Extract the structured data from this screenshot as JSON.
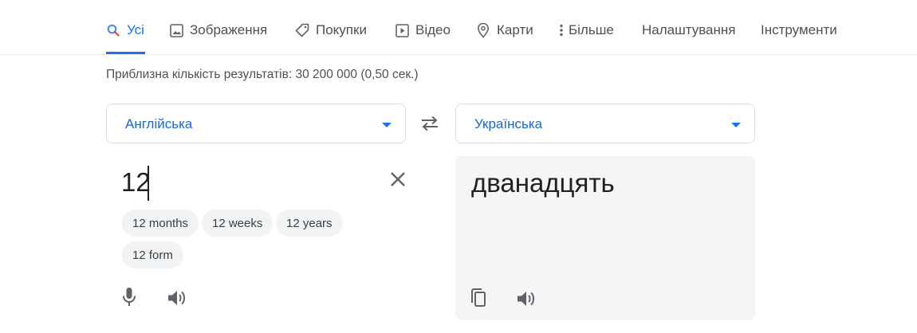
{
  "nav": {
    "tabs": [
      {
        "label": "Усі",
        "icon": "search-icon"
      },
      {
        "label": "Зображення",
        "icon": "image-icon"
      },
      {
        "label": "Покупки",
        "icon": "tag-icon"
      },
      {
        "label": "Відео",
        "icon": "play-icon"
      },
      {
        "label": "Карти",
        "icon": "map-pin-icon"
      },
      {
        "label": "Більше",
        "icon": "more-vert-icon"
      },
      {
        "label": "Налаштування"
      },
      {
        "label": "Інструменти"
      }
    ]
  },
  "results": {
    "text": "Приблизна кількість результатів: 30 200 000 (0,50 сек.)"
  },
  "translator": {
    "source_lang": "Англійська",
    "target_lang": "Українська",
    "source_text": "12",
    "target_text": "дванадцять",
    "suggestions": [
      "12 months",
      "12 weeks",
      "12 years",
      "12 form"
    ]
  },
  "colors": {
    "accent": "#1a73e8",
    "text": "#202124",
    "muted": "#4d5156",
    "panel_bg": "#f5f5f5"
  }
}
